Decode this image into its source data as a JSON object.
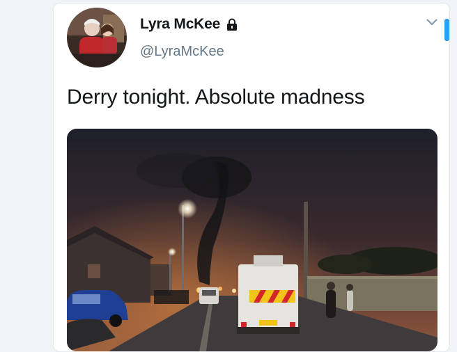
{
  "tweet": {
    "display_name": "Lyra McKee",
    "handle": "@LyraMcKee",
    "text": "Derry tonight. Absolute madness",
    "protected": true
  },
  "icons": {
    "lock": "lock-icon",
    "caret": "chevron-down-icon"
  },
  "colors": {
    "handle": "#657786",
    "accent": "#2aa3ef"
  }
}
